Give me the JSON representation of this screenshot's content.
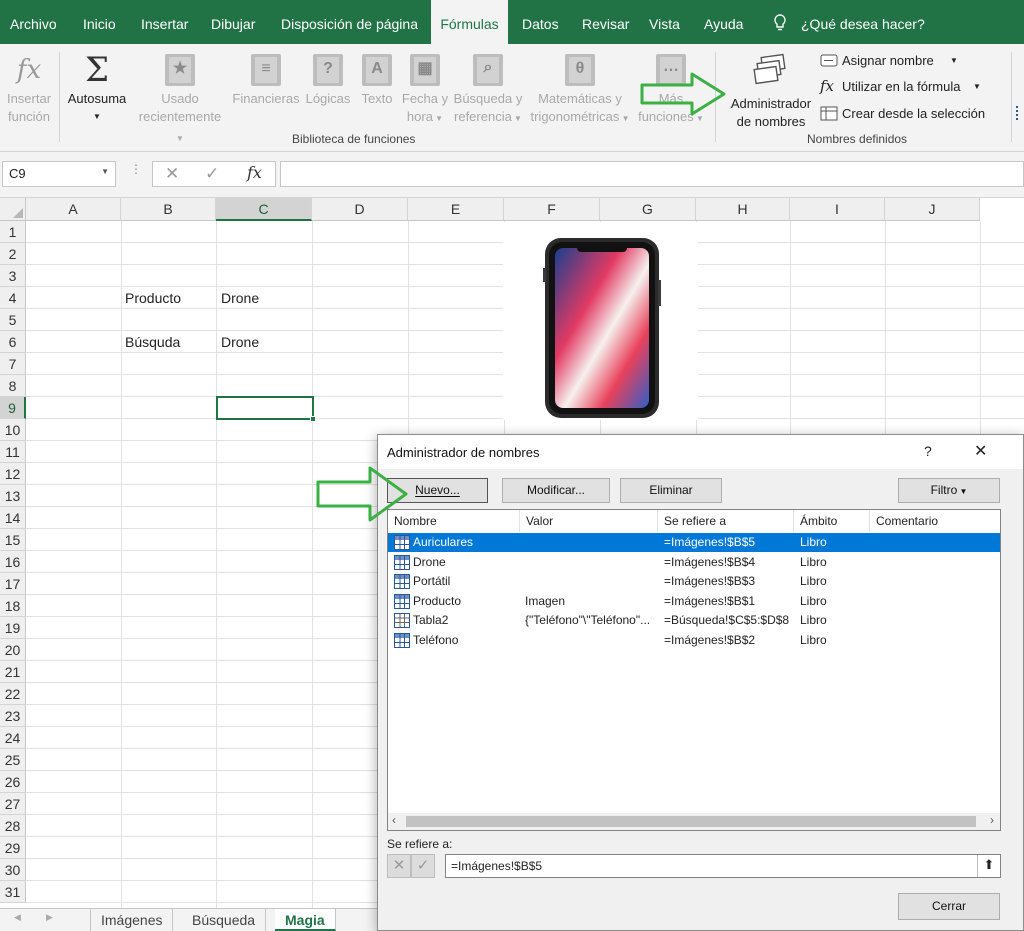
{
  "menu": {
    "tabs": [
      "Archivo",
      "Inicio",
      "Insertar",
      "Dibujar",
      "Disposición de página",
      "Fórmulas",
      "Datos",
      "Revisar",
      "Vista",
      "Ayuda"
    ],
    "active_tab": "Fórmulas",
    "search_placeholder": "¿Qué desea hacer?"
  },
  "ribbon": {
    "insert_function": [
      "Insertar",
      "función"
    ],
    "autosum": "Autosuma",
    "recent": [
      "Usado",
      "recientemente"
    ],
    "financial": "Financieras",
    "logical": "Lógicas",
    "text": "Texto",
    "datetime": [
      "Fecha y",
      "hora"
    ],
    "lookup": [
      "Búsqueda y",
      "referencia"
    ],
    "math": [
      "Matemáticas y",
      "trigonométricas"
    ],
    "more": [
      "Más",
      "funciones"
    ],
    "library_label": "Biblioteca de funciones",
    "name_manager": [
      "Administrador",
      "de nombres"
    ],
    "define_name": "Asignar nombre",
    "use_in_formula": "Utilizar en la fórmula",
    "create_from_selection": "Crear desde la selección",
    "defined_names_label": "Nombres definidos"
  },
  "formula_bar": {
    "name_box": "C9",
    "fx": "fx",
    "value": ""
  },
  "grid": {
    "columns": [
      "A",
      "B",
      "C",
      "D",
      "E",
      "F",
      "G",
      "H",
      "I",
      "J"
    ],
    "selected_column": "C",
    "rows": [
      "1",
      "2",
      "3",
      "4",
      "5",
      "6",
      "7",
      "8",
      "9",
      "10",
      "11",
      "12",
      "13",
      "14",
      "15",
      "16",
      "17",
      "18",
      "19",
      "20",
      "21",
      "22",
      "23",
      "24",
      "25",
      "26",
      "27",
      "28",
      "29",
      "30",
      "31"
    ],
    "selected_row": "9",
    "cells": {
      "B4": "Producto",
      "C4": "Drone",
      "B6": "Búsquda",
      "C6": "Drone"
    }
  },
  "sheets": {
    "tabs": [
      "Imágenes",
      "Búsqueda",
      "Magia"
    ],
    "active": "Magia"
  },
  "dialog": {
    "title": "Administrador de nombres",
    "help": "?",
    "close": "✕",
    "new_button": "Nuevo...",
    "edit_button": "Modificar...",
    "delete_button": "Eliminar",
    "filter_button": "Filtro",
    "columns": [
      "Nombre",
      "Valor",
      "Se refiere a",
      "Ámbito",
      "Comentario"
    ],
    "rows": [
      {
        "name": "Auriculares",
        "value": "",
        "refers": "=Imágenes!$B$5",
        "scope": "Libro",
        "comment": "",
        "selected": true,
        "icon": "named-range-icon"
      },
      {
        "name": "Drone",
        "value": "",
        "refers": "=Imágenes!$B$4",
        "scope": "Libro",
        "comment": "",
        "selected": false,
        "icon": "named-range-icon"
      },
      {
        "name": "Portátil",
        "value": "",
        "refers": "=Imágenes!$B$3",
        "scope": "Libro",
        "comment": "",
        "selected": false,
        "icon": "named-range-icon"
      },
      {
        "name": "Producto",
        "value": "Imagen",
        "refers": "=Imágenes!$B$1",
        "scope": "Libro",
        "comment": "",
        "selected": false,
        "icon": "named-range-icon"
      },
      {
        "name": "Tabla2",
        "value": "{\"Teléfono\"\\\"Teléfono\"...",
        "refers": "=Búsqueda!$C$5:$D$8",
        "scope": "Libro",
        "comment": "",
        "selected": false,
        "icon": "table-icon"
      },
      {
        "name": "Teléfono",
        "value": "",
        "refers": "=Imágenes!$B$2",
        "scope": "Libro",
        "comment": "",
        "selected": false,
        "icon": "named-range-icon"
      }
    ],
    "refers_to_label": "Se refiere a:",
    "refers_to_value": "=Imágenes!$B$5",
    "close_button": "Cerrar"
  },
  "colors": {
    "excel_green": "#217346",
    "arrow_green": "#3cb043",
    "selection_blue": "#0078d7"
  }
}
